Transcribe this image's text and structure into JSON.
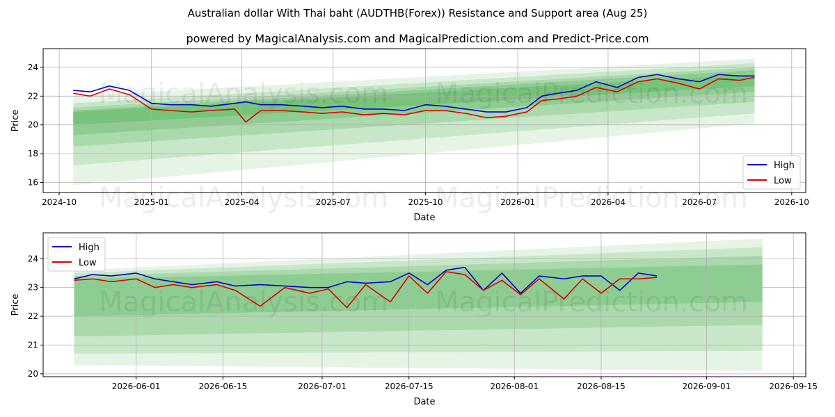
{
  "title": "Australian dollar With Thai baht (AUDTHB(Forex)) Resistance and Support area (Aug 25)",
  "subtitle": "powered by MagicalAnalysis.com and MagicalPrediction.com and Predict-Price.com",
  "watermarks": [
    "MagicalAnalysis.com",
    "MagicalPrediction.com"
  ],
  "colors": {
    "high": "#0000cc",
    "low": "#dd0000",
    "band": "#4caf50",
    "grid": "#b0b0b0"
  },
  "chart_data": [
    {
      "type": "line",
      "xlabel": "Date",
      "ylabel": "Price",
      "x_ticks": [
        "2024-10",
        "2025-01",
        "2025-04",
        "2025-07",
        "2025-10",
        "2026-01",
        "2026-04",
        "2026-07",
        "2026-10"
      ],
      "y_ticks": [
        16,
        18,
        20,
        22,
        24
      ],
      "xlim": [
        "2024-09-15",
        "2026-10-15"
      ],
      "ylim": [
        15.3,
        25.3
      ],
      "grid": true,
      "legend": {
        "position": "lower right",
        "entries": [
          "High",
          "Low"
        ]
      },
      "bands": {
        "x": [
          "2024-10-15",
          "2026-08-25"
        ],
        "fan_from": [
          [
            15.8,
            22.0
          ],
          [
            17.2,
            21.5
          ],
          [
            18.5,
            21.2
          ],
          [
            19.3,
            21.0
          ],
          [
            20.0,
            20.9
          ]
        ],
        "fan_to": [
          [
            20.1,
            24.6
          ],
          [
            20.8,
            24.3
          ],
          [
            21.6,
            24.0
          ],
          [
            22.3,
            23.8
          ],
          [
            22.7,
            23.5
          ]
        ]
      },
      "series": [
        {
          "name": "High",
          "x": [
            "2024-10-15",
            "2024-11-01",
            "2024-11-20",
            "2024-12-10",
            "2025-01-01",
            "2025-01-20",
            "2025-02-10",
            "2025-03-01",
            "2025-03-25",
            "2025-04-05",
            "2025-04-20",
            "2025-05-10",
            "2025-06-01",
            "2025-06-20",
            "2025-07-10",
            "2025-08-01",
            "2025-08-20",
            "2025-09-10",
            "2025-10-01",
            "2025-10-20",
            "2025-11-10",
            "2025-12-01",
            "2025-12-20",
            "2026-01-10",
            "2026-01-25",
            "2026-02-10",
            "2026-03-01",
            "2026-03-20",
            "2026-04-10",
            "2026-05-01",
            "2026-05-20",
            "2026-06-10",
            "2026-07-01",
            "2026-07-20",
            "2026-08-10",
            "2026-08-25"
          ],
          "y": [
            22.4,
            22.3,
            22.7,
            22.4,
            21.5,
            21.4,
            21.4,
            21.3,
            21.5,
            21.6,
            21.4,
            21.4,
            21.3,
            21.2,
            21.3,
            21.1,
            21.1,
            21.0,
            21.4,
            21.3,
            21.1,
            20.9,
            20.9,
            21.2,
            22.0,
            22.2,
            22.4,
            23.0,
            22.6,
            23.3,
            23.5,
            23.2,
            23.0,
            23.5,
            23.4,
            23.4
          ]
        },
        {
          "name": "Low",
          "x": [
            "2024-10-15",
            "2024-11-01",
            "2024-11-20",
            "2024-12-10",
            "2025-01-01",
            "2025-01-20",
            "2025-02-10",
            "2025-03-01",
            "2025-03-25",
            "2025-04-05",
            "2025-04-20",
            "2025-05-10",
            "2025-06-01",
            "2025-06-20",
            "2025-07-10",
            "2025-08-01",
            "2025-08-20",
            "2025-09-10",
            "2025-10-01",
            "2025-10-20",
            "2025-11-10",
            "2025-12-01",
            "2025-12-20",
            "2026-01-10",
            "2026-01-25",
            "2026-02-10",
            "2026-03-01",
            "2026-03-20",
            "2026-04-10",
            "2026-05-01",
            "2026-05-20",
            "2026-06-10",
            "2026-07-01",
            "2026-07-20",
            "2026-08-10",
            "2026-08-25"
          ],
          "y": [
            22.2,
            22.0,
            22.5,
            22.1,
            21.1,
            21.0,
            20.9,
            21.0,
            21.1,
            20.2,
            21.0,
            21.0,
            20.9,
            20.8,
            20.9,
            20.7,
            20.8,
            20.7,
            21.0,
            21.0,
            20.8,
            20.5,
            20.6,
            20.9,
            21.7,
            21.8,
            22.0,
            22.6,
            22.3,
            23.0,
            23.2,
            22.9,
            22.5,
            23.2,
            23.1,
            23.3
          ]
        }
      ]
    },
    {
      "type": "line",
      "xlabel": "Date",
      "ylabel": "Price",
      "x_ticks": [
        "2026-06-01",
        "2026-06-15",
        "2026-07-01",
        "2026-07-15",
        "2026-08-01",
        "2026-08-15",
        "2026-09-01",
        "2026-09-15"
      ],
      "y_ticks": [
        20,
        21,
        22,
        23,
        24
      ],
      "xlim": [
        "2026-05-17",
        "2026-09-17"
      ],
      "ylim": [
        19.9,
        24.9
      ],
      "grid": true,
      "legend": {
        "position": "upper left",
        "entries": [
          "High",
          "Low"
        ]
      },
      "bands": {
        "x": [
          "2026-05-22",
          "2026-09-10"
        ],
        "fan_from": [
          [
            20.3,
            23.6
          ],
          [
            20.7,
            23.5
          ],
          [
            21.3,
            23.4
          ],
          [
            22.0,
            23.3
          ]
        ],
        "fan_to": [
          [
            20.1,
            24.7
          ],
          [
            20.8,
            24.4
          ],
          [
            21.7,
            24.1
          ],
          [
            22.5,
            23.8
          ]
        ]
      },
      "series": [
        {
          "name": "High",
          "x": [
            "2026-05-22",
            "2026-05-25",
            "2026-05-28",
            "2026-06-01",
            "2026-06-04",
            "2026-06-07",
            "2026-06-10",
            "2026-06-14",
            "2026-06-17",
            "2026-06-21",
            "2026-06-25",
            "2026-06-29",
            "2026-07-02",
            "2026-07-05",
            "2026-07-08",
            "2026-07-12",
            "2026-07-15",
            "2026-07-18",
            "2026-07-21",
            "2026-07-24",
            "2026-07-27",
            "2026-07-30",
            "2026-08-02",
            "2026-08-05",
            "2026-08-09",
            "2026-08-12",
            "2026-08-15",
            "2026-08-18",
            "2026-08-21",
            "2026-08-24"
          ],
          "y": [
            23.3,
            23.45,
            23.4,
            23.5,
            23.3,
            23.2,
            23.1,
            23.2,
            23.05,
            23.1,
            23.05,
            23.0,
            23.0,
            23.2,
            23.15,
            23.2,
            23.5,
            23.1,
            23.6,
            23.7,
            22.9,
            23.5,
            22.8,
            23.4,
            23.3,
            23.4,
            23.4,
            22.9,
            23.5,
            23.4
          ]
        },
        {
          "name": "Low",
          "x": [
            "2026-05-22",
            "2026-05-25",
            "2026-05-28",
            "2026-06-01",
            "2026-06-04",
            "2026-06-07",
            "2026-06-10",
            "2026-06-14",
            "2026-06-17",
            "2026-06-21",
            "2026-06-25",
            "2026-06-29",
            "2026-07-02",
            "2026-07-05",
            "2026-07-08",
            "2026-07-12",
            "2026-07-15",
            "2026-07-18",
            "2026-07-21",
            "2026-07-24",
            "2026-07-27",
            "2026-07-30",
            "2026-08-02",
            "2026-08-05",
            "2026-08-09",
            "2026-08-12",
            "2026-08-15",
            "2026-08-18",
            "2026-08-21",
            "2026-08-24"
          ],
          "y": [
            23.25,
            23.3,
            23.2,
            23.3,
            23.0,
            23.1,
            23.0,
            23.1,
            22.9,
            22.35,
            23.0,
            22.8,
            22.95,
            22.3,
            23.1,
            22.5,
            23.4,
            22.8,
            23.55,
            23.45,
            22.9,
            23.25,
            22.75,
            23.3,
            22.6,
            23.3,
            22.8,
            23.3,
            23.3,
            23.35
          ]
        }
      ]
    }
  ]
}
